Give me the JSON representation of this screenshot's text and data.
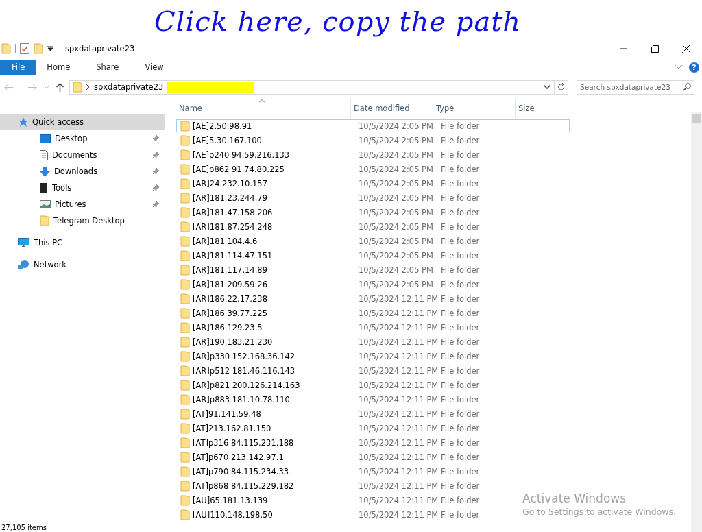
{
  "window": {
    "title": "spxdataprivate23"
  },
  "annotation": {
    "text": "Click here, copy the path"
  },
  "ribbon": {
    "tabs": [
      {
        "label": "File",
        "kind": "file"
      },
      {
        "label": "Home",
        "kind": "tab"
      },
      {
        "label": "Share",
        "kind": "tab"
      },
      {
        "label": "View",
        "kind": "tab"
      }
    ],
    "help": "?"
  },
  "address": {
    "crumbs": [
      "spxdataprivate23"
    ],
    "redacted": true
  },
  "search": {
    "placeholder": "Search spxdataprivate23"
  },
  "nav": [
    {
      "label": "Quick access",
      "kind": "star",
      "selected": true,
      "children": [
        {
          "label": "Desktop",
          "kind": "desktop",
          "pinned": true
        },
        {
          "label": "Documents",
          "kind": "documents",
          "pinned": true
        },
        {
          "label": "Downloads",
          "kind": "downloads",
          "pinned": true
        },
        {
          "label": "Tools",
          "kind": "chip",
          "pinned": true
        },
        {
          "label": "Pictures",
          "kind": "pictures",
          "pinned": true
        },
        {
          "label": "Telegram Desktop",
          "kind": "folder",
          "pinned": false
        }
      ]
    },
    {
      "label": "This PC",
      "kind": "pc",
      "selected": false
    },
    {
      "label": "Network",
      "kind": "network",
      "selected": false
    }
  ],
  "table": {
    "columns": [
      "Name",
      "Date modified",
      "Type",
      "Size"
    ],
    "rows": [
      {
        "name": "[AE]2.50.98.91",
        "date": "10/5/2024 2:05 PM",
        "type": "File folder",
        "selected": true
      },
      {
        "name": "[AE]5.30.167.100",
        "date": "10/5/2024 2:05 PM",
        "type": "File folder",
        "selected": false
      },
      {
        "name": "[AE]p240 94.59.216.133",
        "date": "10/5/2024 2:05 PM",
        "type": "File folder",
        "selected": false
      },
      {
        "name": "[AE]p862 91.74.80.225",
        "date": "10/5/2024 2:05 PM",
        "type": "File folder",
        "selected": false
      },
      {
        "name": "[AR]24.232.10.157",
        "date": "10/5/2024 2:05 PM",
        "type": "File folder",
        "selected": false
      },
      {
        "name": "[AR]181.23.244.79",
        "date": "10/5/2024 2:05 PM",
        "type": "File folder",
        "selected": false
      },
      {
        "name": "[AR]181.47.158.206",
        "date": "10/5/2024 2:05 PM",
        "type": "File folder",
        "selected": false
      },
      {
        "name": "[AR]181.87.254.248",
        "date": "10/5/2024 2:05 PM",
        "type": "File folder",
        "selected": false
      },
      {
        "name": "[AR]181.104.4.6",
        "date": "10/5/2024 2:05 PM",
        "type": "File folder",
        "selected": false
      },
      {
        "name": "[AR]181.114.47.151",
        "date": "10/5/2024 2:05 PM",
        "type": "File folder",
        "selected": false
      },
      {
        "name": "[AR]181.117.14.89",
        "date": "10/5/2024 2:05 PM",
        "type": "File folder",
        "selected": false
      },
      {
        "name": "[AR]181.209.59.26",
        "date": "10/5/2024 2:05 PM",
        "type": "File folder",
        "selected": false
      },
      {
        "name": "[AR]186.22.17.238",
        "date": "10/5/2024 12:11 PM",
        "type": "File folder",
        "selected": false
      },
      {
        "name": "[AR]186.39.77.225",
        "date": "10/5/2024 12:11 PM",
        "type": "File folder",
        "selected": false
      },
      {
        "name": "[AR]186.129.23.5",
        "date": "10/5/2024 12:11 PM",
        "type": "File folder",
        "selected": false
      },
      {
        "name": "[AR]190.183.21.230",
        "date": "10/5/2024 12:11 PM",
        "type": "File folder",
        "selected": false
      },
      {
        "name": "[AR]p330 152.168.36.142",
        "date": "10/5/2024 12:11 PM",
        "type": "File folder",
        "selected": false
      },
      {
        "name": "[AR]p512 181.46.116.143",
        "date": "10/5/2024 12:11 PM",
        "type": "File folder",
        "selected": false
      },
      {
        "name": "[AR]p821 200.126.214.163",
        "date": "10/5/2024 12:11 PM",
        "type": "File folder",
        "selected": false
      },
      {
        "name": "[AR]p883 181.10.78.110",
        "date": "10/5/2024 12:11 PM",
        "type": "File folder",
        "selected": false
      },
      {
        "name": "[AT]91.141.59.48",
        "date": "10/5/2024 12:11 PM",
        "type": "File folder",
        "selected": false
      },
      {
        "name": "[AT]213.162.81.150",
        "date": "10/5/2024 12:11 PM",
        "type": "File folder",
        "selected": false
      },
      {
        "name": "[AT]p316 84.115.231.188",
        "date": "10/5/2024 12:11 PM",
        "type": "File folder",
        "selected": false
      },
      {
        "name": "[AT]p670 213.142.97.1",
        "date": "10/5/2024 12:11 PM",
        "type": "File folder",
        "selected": false
      },
      {
        "name": "[AT]p790 84.115.234.33",
        "date": "10/5/2024 12:11 PM",
        "type": "File folder",
        "selected": false
      },
      {
        "name": "[AT]p868 84.115.229.182",
        "date": "10/5/2024 12:11 PM",
        "type": "File folder",
        "selected": false
      },
      {
        "name": "[AU]65.181.13.139",
        "date": "10/5/2024 12:11 PM",
        "type": "File folder",
        "selected": false
      },
      {
        "name": "[AU]110.148.198.50",
        "date": "10/5/2024 12:11 PM",
        "type": "File folder",
        "selected": false
      }
    ]
  },
  "status_bar": {
    "count": "27,105 items"
  },
  "activation": {
    "title": "Activate Windows",
    "subtitle": "Go to Settings to activate Windows."
  }
}
